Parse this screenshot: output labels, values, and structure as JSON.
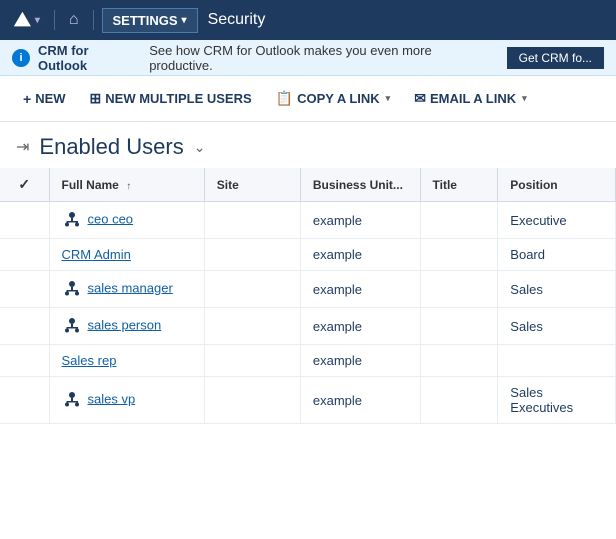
{
  "nav": {
    "logo_icon": "▲▲",
    "chevron": "▾",
    "settings_label": "SETTINGS",
    "settings_chevron": "▾",
    "security_label": "Security"
  },
  "banner": {
    "icon_text": "i",
    "title": "CRM for Outlook",
    "description": "See how CRM for Outlook makes you even more productive.",
    "button_label": "Get CRM fo..."
  },
  "toolbar": {
    "new_label": "NEW",
    "new_multiple_label": "NEW MULTIPLE USERS",
    "copy_link_label": "COPY A LINK",
    "email_link_label": "EMAIL A LINK"
  },
  "page_header": {
    "title": "Enabled Users",
    "dropdown_icon": "⌄"
  },
  "table": {
    "columns": [
      {
        "id": "check",
        "label": "✓"
      },
      {
        "id": "fullname",
        "label": "Full Name",
        "sortable": true,
        "sort_dir": "asc"
      },
      {
        "id": "site",
        "label": "Site"
      },
      {
        "id": "businessunit",
        "label": "Business Unit..."
      },
      {
        "id": "title",
        "label": "Title"
      },
      {
        "id": "position",
        "label": "Position"
      }
    ],
    "rows": [
      {
        "has_icon": true,
        "fullname": "ceo ceo",
        "site": "",
        "businessunit": "example",
        "title": "",
        "position": "Executive"
      },
      {
        "has_icon": false,
        "fullname": "CRM Admin",
        "site": "",
        "businessunit": "example",
        "title": "",
        "position": "Board"
      },
      {
        "has_icon": true,
        "fullname": "sales manager",
        "site": "",
        "businessunit": "example",
        "title": "",
        "position": "Sales"
      },
      {
        "has_icon": true,
        "fullname": "sales person",
        "site": "",
        "businessunit": "example",
        "title": "",
        "position": "Sales"
      },
      {
        "has_icon": false,
        "fullname": "Sales rep",
        "site": "",
        "businessunit": "example",
        "title": "",
        "position": ""
      },
      {
        "has_icon": true,
        "fullname": "sales vp",
        "site": "",
        "businessunit": "example",
        "title": "",
        "position": "Sales Executives"
      }
    ]
  }
}
